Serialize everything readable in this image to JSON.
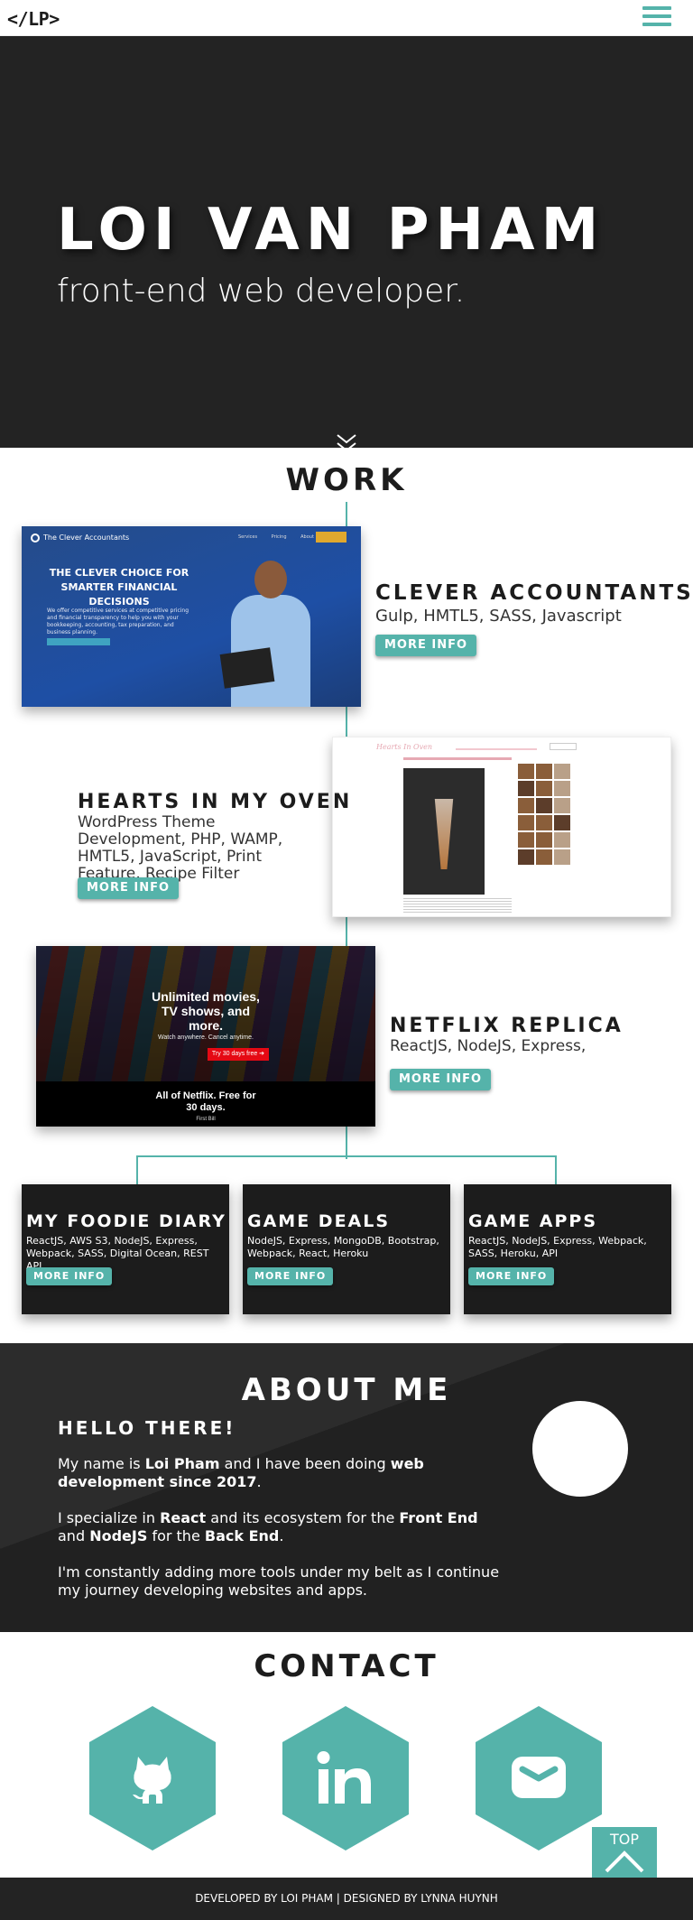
{
  "nav": {
    "logo_left": "</",
    "logo_mid": "LP",
    "logo_right": ">",
    "menu_icon": "hamburger-icon"
  },
  "hero": {
    "name": "LOI VAN PHAM",
    "tagline": "front-end web developer.",
    "scroll_icon": "double-chevron-down-icon"
  },
  "work": {
    "title": "WORK",
    "projects": [
      {
        "title": "CLEVER ACCOUNTANTS",
        "tech": "Gulp, HMTL5, SASS, Javascript",
        "button": "MORE INFO",
        "shot": {
          "brand": "The Clever Accountants",
          "links": "Services Pricing About Us",
          "headline": "THE CLEVER CHOICE FOR SMARTER FINANCIAL DECISIONS",
          "copy": "We offer competitive services at competitive pricing and financial transparency to help you with your bookkeeping, accounting, tax preparation, and business planning."
        }
      },
      {
        "title": "HEARTS IN MY OVEN",
        "tech": "WordPress Theme Development, PHP, WAMP, HMTL5, JavaScript, Print Feature, Recipe Filter",
        "button": "MORE INFO",
        "shot": {
          "brand": "Hearts In Oven"
        }
      },
      {
        "title": "NETFLIX REPLICA",
        "tech": "ReactJS, NodeJS, Express,",
        "button": "MORE INFO",
        "shot": {
          "headline": "Unlimited movies, TV shows, and more.",
          "sub": "Watch anywhere. Cancel anytime.",
          "cta": "Try 30 days free ➔",
          "headline2": "All of Netflix. Free for 30 days.",
          "link": "First Bill"
        }
      }
    ],
    "cards": [
      {
        "title": "MY FOODIE DIARY",
        "tech": "ReactJS, AWS S3, NodeJS, Express, Webpack, SASS, Digital Ocean, REST API",
        "button": "MORE INFO"
      },
      {
        "title": "GAME DEALS",
        "tech": "NodeJS, Express, MongoDB, Bootstrap, Webpack, React, Heroku",
        "button": "MORE INFO"
      },
      {
        "title": "GAME APPS",
        "tech": "ReactJS, NodeJS, Express, Webpack, SASS, Heroku, API",
        "button": "MORE INFO"
      }
    ]
  },
  "about": {
    "title": "ABOUT ME",
    "hello": "HELLO THERE!",
    "p1": [
      "My name is ",
      "Loi Pham",
      " and I have been doing ",
      "web development since 2017",
      "."
    ],
    "p2": [
      "I specialize in ",
      "React",
      " and its ecosystem for the ",
      "Front End",
      " and ",
      "NodeJS",
      " for the ",
      "Back End",
      "."
    ],
    "p3": "I'm constantly adding more tools under my belt as I continue my journey developing websites and apps."
  },
  "contact": {
    "title": "CONTACT",
    "links": [
      {
        "name": "github",
        "icon": "github-icon"
      },
      {
        "name": "linkedin",
        "icon": "linkedin-icon",
        "text": "in"
      },
      {
        "name": "email",
        "icon": "mail-icon"
      }
    ]
  },
  "top_button": {
    "label": "TOP"
  },
  "footer": {
    "text": "DEVELOPED BY LOI PHAM | DESIGNED BY LYNNA HUYNH"
  },
  "colors": {
    "accent": "#55b3aa",
    "dark": "#232323"
  }
}
